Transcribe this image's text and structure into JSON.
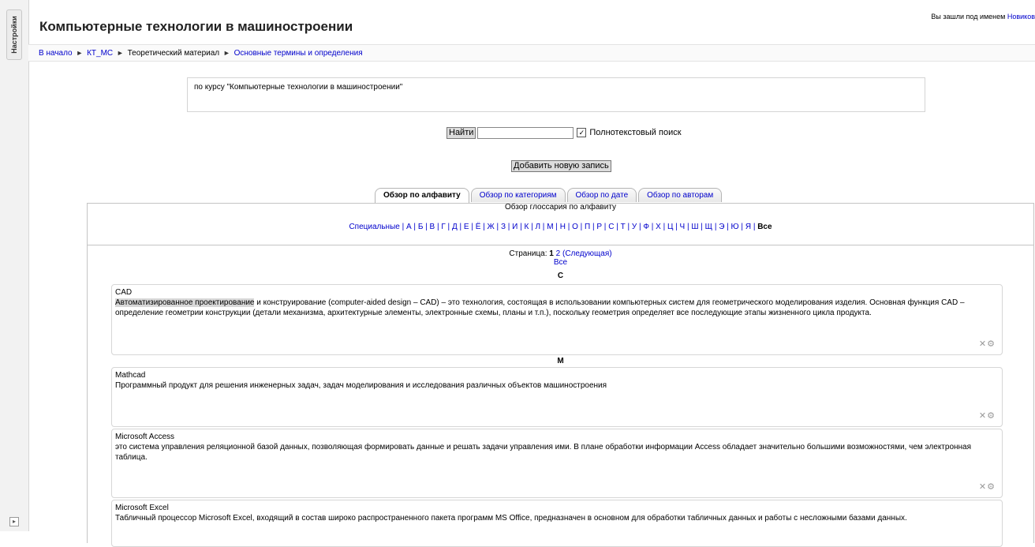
{
  "settings_dock": {
    "tab_label": "Настройки",
    "toggle_icon": "expand-icon"
  },
  "header": {
    "title": "Компьютерные технологии в машиностроении",
    "login_prefix": "Вы зашли под именем",
    "login_user": "Новиков"
  },
  "breadcrumb": {
    "home": "В начало",
    "course": "КТ_МС",
    "section": "Теоретический материал",
    "page": "Основные термины и определения"
  },
  "intro": {
    "text": "по курсу \"Компьютерные технологии в машиностроении\""
  },
  "search": {
    "button": "Найти",
    "value": "",
    "fulltext_label": "Полнотекстовый поиск",
    "fulltext_checked": true
  },
  "add_entry": "Добавить новую запись",
  "tabs": [
    {
      "label": "Обзор по алфавиту",
      "active": true
    },
    {
      "label": "Обзор по категориям",
      "active": false
    },
    {
      "label": "Обзор по дате",
      "active": false
    },
    {
      "label": "Обзор по авторам",
      "active": false
    }
  ],
  "browse_heading": "Обзор глоссария по алфавиту",
  "alphabet": {
    "special": "Специальные",
    "letters": [
      "А",
      "Б",
      "В",
      "Г",
      "Д",
      "Е",
      "Ё",
      "Ж",
      "З",
      "И",
      "К",
      "Л",
      "М",
      "Н",
      "О",
      "П",
      "Р",
      "С",
      "Т",
      "У",
      "Ф",
      "Х",
      "Ц",
      "Ч",
      "Ш",
      "Щ",
      "Э",
      "Ю",
      "Я"
    ],
    "all": "Все"
  },
  "paging": {
    "label": "Страница:",
    "current": "1",
    "next_page": "2",
    "next_label": "(Следующая)",
    "all": "Все"
  },
  "groups": [
    {
      "letter": "C",
      "entries": [
        {
          "term": "CAD",
          "highlight": "Автоматизированное проектирование",
          "definition": " и конструирование (computer-aided design – CAD) – это технология, состоящая в использовании компьютерных систем для геометрического моделирования изделия. Основная функция CAD – определение геометрии конструкции (детали механизма, архитектурные элементы, электронные схемы, планы и т.п.), поскольку геометрия определяет все последующие этапы жизненного цикла продукта."
        }
      ]
    },
    {
      "letter": "M",
      "entries": [
        {
          "term": "Mathcad",
          "definition": "Программный продукт для решения инженерных задач, задач моделирования и исследования различных объектов машиностроения"
        },
        {
          "term": "Microsoft Access",
          "definition": "это система управления реляционной базой данных, позволяющая формировать данные и решать задачи управления ими. В плане обработки информации Access обладает значительно большими возможностями, чем электронная таблица."
        },
        {
          "term": "Microsoft Excel",
          "definition": "Табличный процессор Microsoft Excel, входящий в состав широко распространенного пакета программ MS Office, предназначен в основном для обработки табличных данных и работы с несложными базами данных."
        }
      ]
    }
  ],
  "entry_icons": {
    "delete": "delete-icon",
    "edit": "gear-icon"
  }
}
